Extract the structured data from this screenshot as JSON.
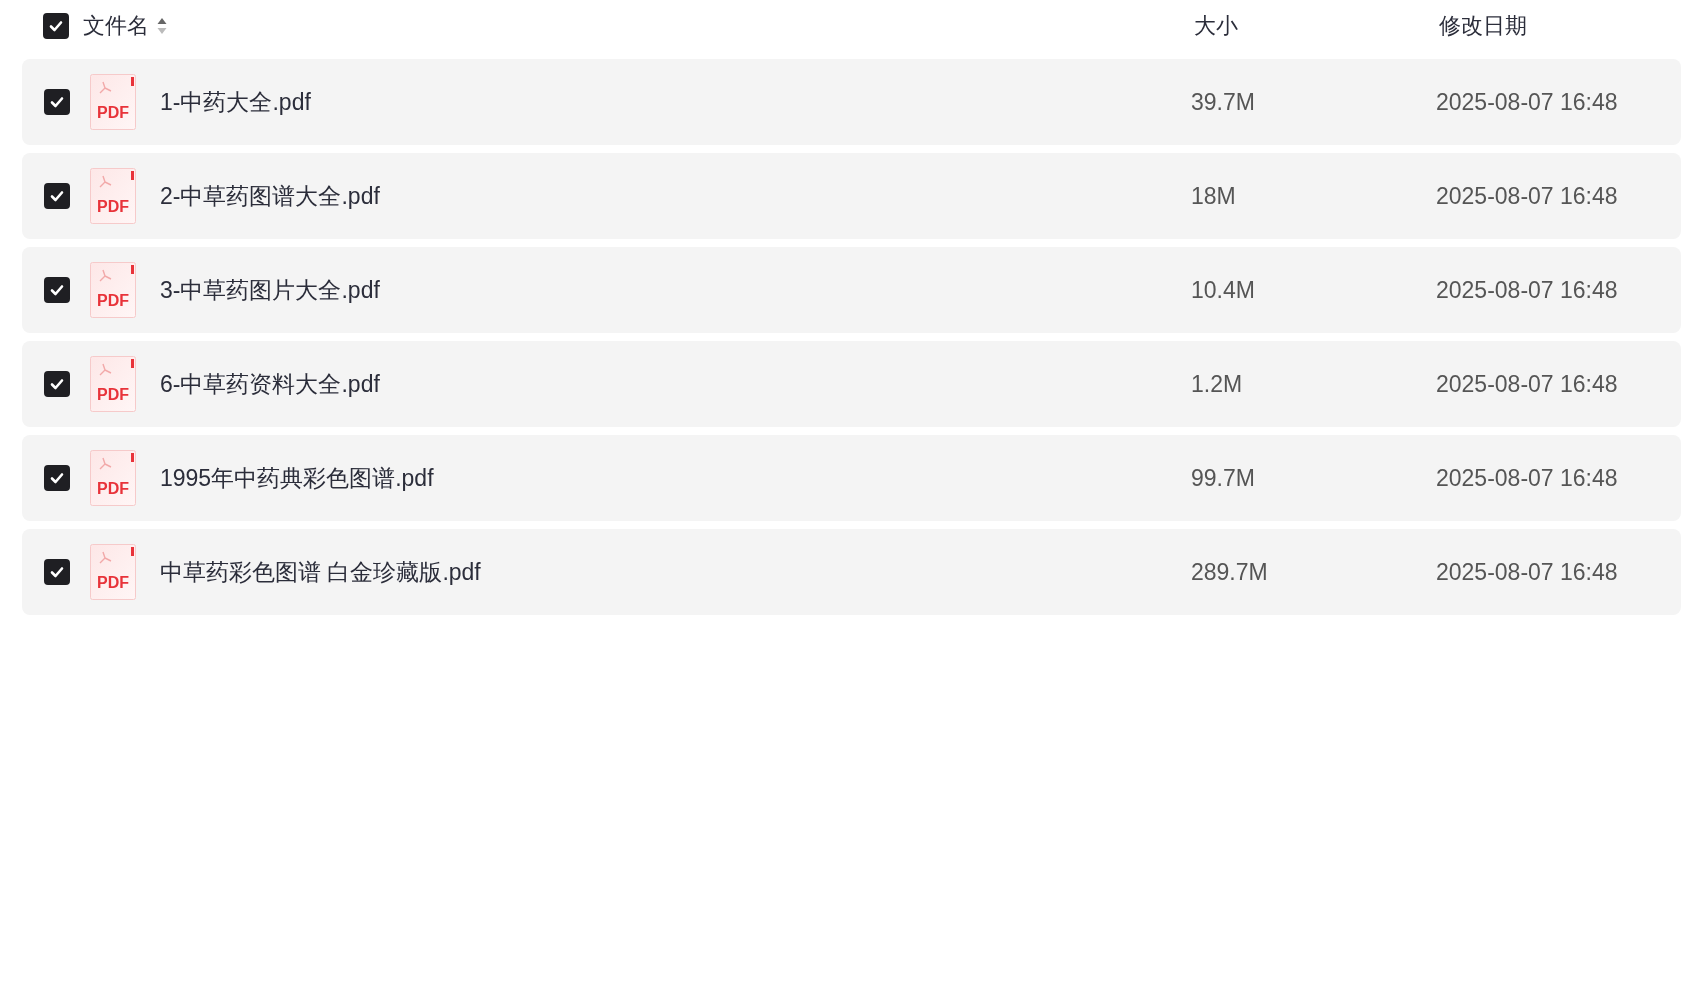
{
  "header": {
    "select_all": {
      "checked": true
    },
    "columns": [
      "文件名",
      "大小",
      "修改日期"
    ]
  },
  "files": [
    {
      "icon_label": "PDF",
      "name": "1-中药大全.pdf",
      "size": "39.7M",
      "modified": "2025-08-07 16:48",
      "checked": true
    },
    {
      "icon_label": "PDF",
      "name": "2-中草药图谱大全.pdf",
      "size": "18M",
      "modified": "2025-08-07 16:48",
      "checked": true
    },
    {
      "icon_label": "PDF",
      "name": "3-中草药图片大全.pdf",
      "size": "10.4M",
      "modified": "2025-08-07 16:48",
      "checked": true
    },
    {
      "icon_label": "PDF",
      "name": "6-中草药资料大全.pdf",
      "size": "1.2M",
      "modified": "2025-08-07 16:48",
      "checked": true
    },
    {
      "icon_label": "PDF",
      "name": "1995年中药典彩色图谱.pdf",
      "size": "99.7M",
      "modified": "2025-08-07 16:48",
      "checked": true
    },
    {
      "icon_label": "PDF",
      "name": "中草药彩色图谱 白金珍藏版.pdf",
      "size": "289.7M",
      "modified": "2025-08-07 16:48",
      "checked": true
    }
  ]
}
